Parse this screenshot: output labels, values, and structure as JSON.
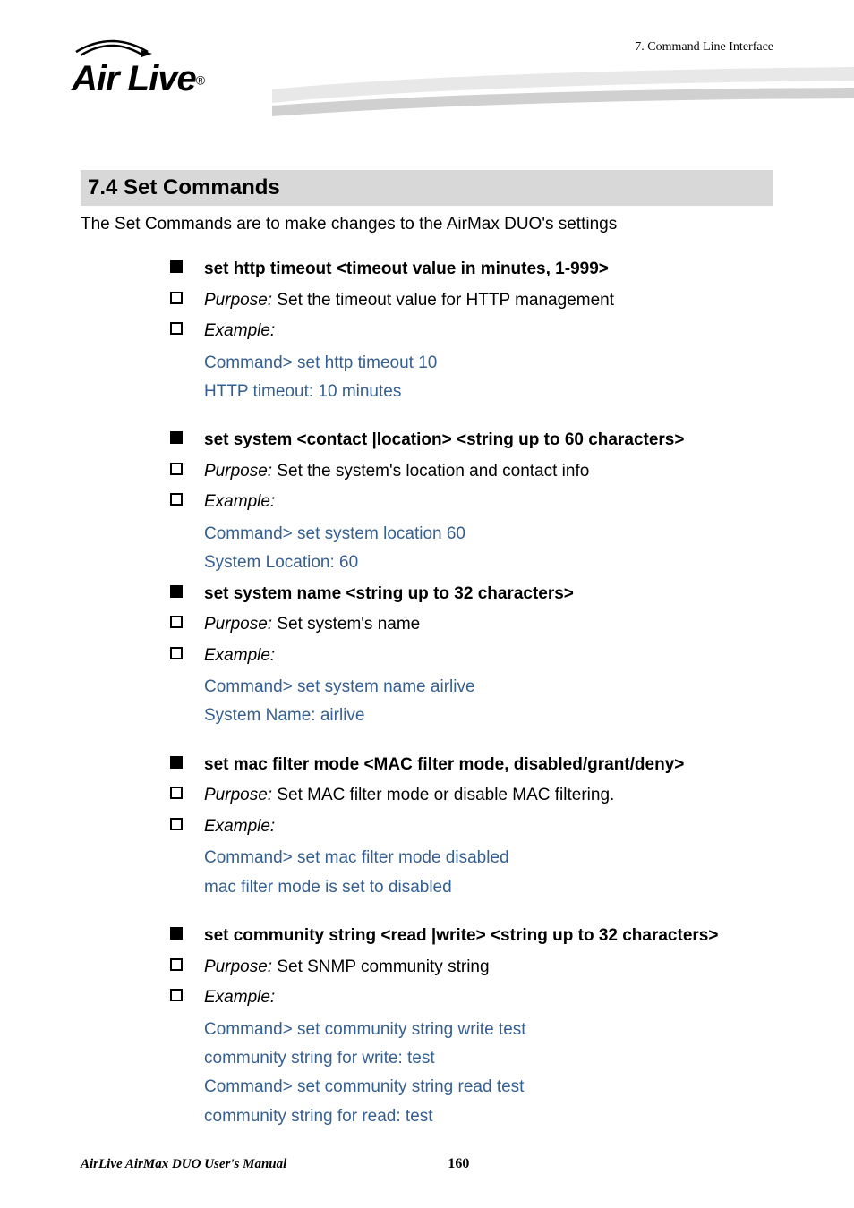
{
  "header": {
    "chapter_label": "7. Command Line Interface",
    "logo_text": "Air Live",
    "logo_reg": "®"
  },
  "section": {
    "heading": "7.4 Set Commands",
    "intro": "The Set Commands are to make changes to the AirMax DUO's settings"
  },
  "blocks": [
    {
      "title": "set http timeout <timeout value in minutes, 1-999>",
      "purpose": "Set the timeout value for HTTP management",
      "example_label": "Example:",
      "lines": [
        "Command> set http timeout 10",
        "HTTP timeout: 10 minutes"
      ]
    },
    {
      "title": "set system <contact |location> <string up to 60 characters>",
      "purpose": "Set the system's location and contact info",
      "example_label": "Example:",
      "lines": [
        "Command> set system location 60",
        "System Location: 60"
      ]
    },
    {
      "title": "set system name <string up to 32 characters>",
      "purpose": "Set system's name",
      "example_label": "Example:",
      "lines": [
        "Command> set system name airlive",
        "System Name: airlive"
      ]
    },
    {
      "title": "set mac filter mode <MAC filter mode, disabled/grant/deny>",
      "purpose": "Set MAC filter mode or disable MAC filtering.",
      "example_label": "Example:",
      "lines": [
        "Command> set mac filter mode disabled",
        "mac filter mode is set to disabled"
      ]
    },
    {
      "title": "set community string <read |write> <string up to 32 characters>",
      "purpose": "Set SNMP community string",
      "example_label": "Example:",
      "lines": [
        "Command> set community string write test",
        "community string for write: test",
        "Command> set community string read test",
        "community string for read: test"
      ]
    }
  ],
  "labels": {
    "purpose_prefix": "Purpose: "
  },
  "footer": {
    "manual_title": "AirLive AirMax DUO User's Manual",
    "page_number": "160"
  }
}
